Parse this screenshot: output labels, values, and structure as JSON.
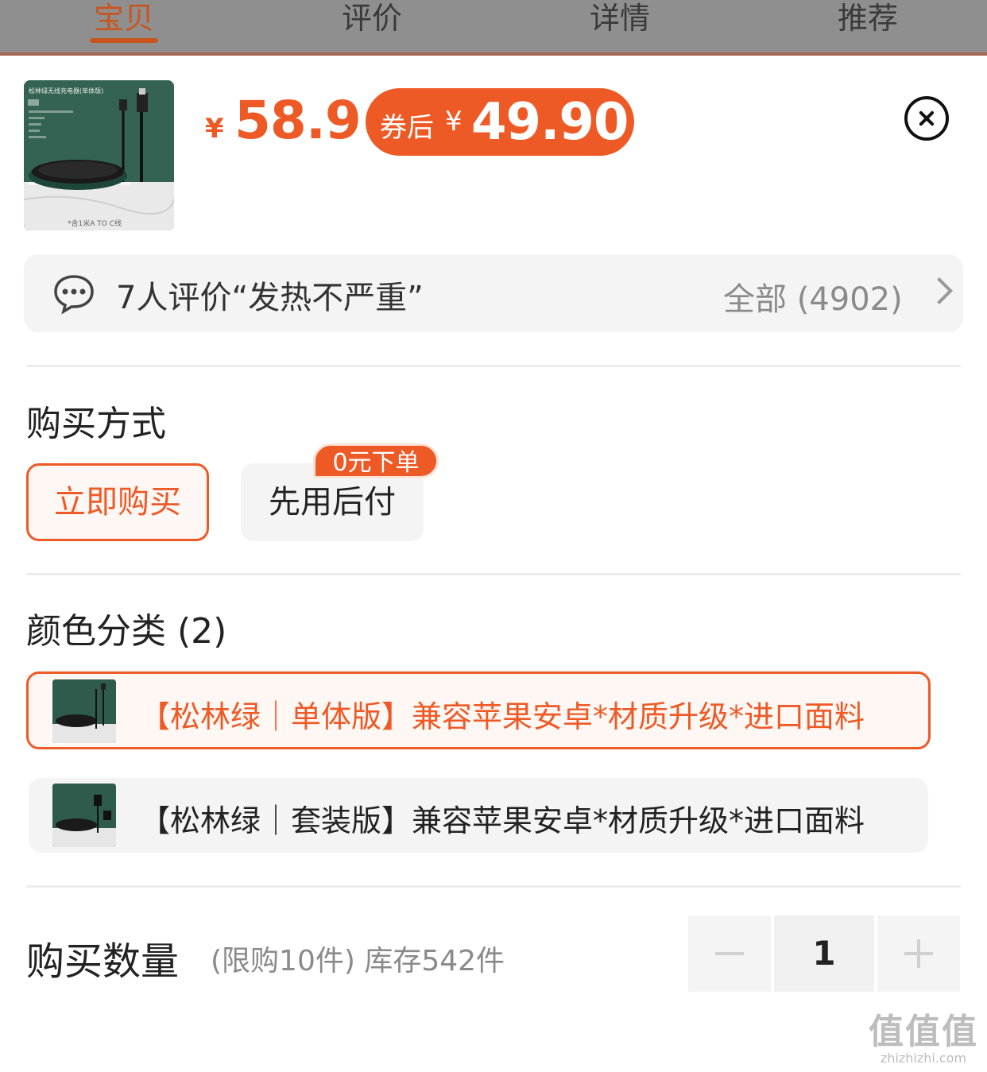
{
  "tabs": [
    {
      "label": "宝贝",
      "active": true
    },
    {
      "label": "评价",
      "active": false
    },
    {
      "label": "详情",
      "active": false
    },
    {
      "label": "推荐",
      "active": false
    }
  ],
  "product": {
    "thumb_title": "松林绿无线充电器(单体版)",
    "thumb_caption": "*含1米A TO C线",
    "price_symbol": "¥",
    "price": "58.9",
    "coupon_label": "券后",
    "coupon_symbol": "¥",
    "coupon_price": "49.90"
  },
  "review": {
    "text": "7人评价“发热不严重”",
    "all_label": "全部 (4902)"
  },
  "purchase_method": {
    "title": "购买方式",
    "options": [
      "立即购买",
      "先用后付"
    ],
    "badge": "0元下单",
    "selected": "立即购买"
  },
  "color": {
    "title": "颜色分类 (2)",
    "options": [
      {
        "label": "【松林绿｜单体版】兼容苹果安卓*材质升级*进口面料",
        "selected": true
      },
      {
        "label": "【松林绿｜套装版】兼容苹果安卓*材质升级*进口面料",
        "selected": false
      }
    ]
  },
  "quantity": {
    "title": "购买数量",
    "note": "(限购10件) 库存542件",
    "value": "1"
  },
  "watermark": {
    "big": "值值值",
    "small": "zhizhizhi.com"
  },
  "colors": {
    "accent": "#ee5a26",
    "option_bg": "#f4f4f4"
  }
}
